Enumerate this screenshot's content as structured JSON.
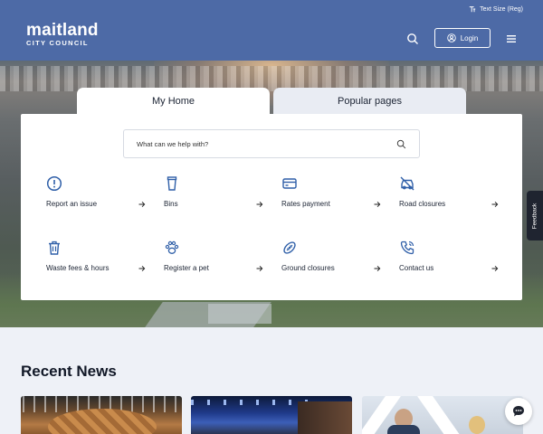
{
  "header": {
    "logo_main": "maitland",
    "logo_sub": "CITY COUNCIL",
    "text_size": "Text Size (Reg)",
    "login_label": "Login"
  },
  "tabs": [
    {
      "label": "My Home"
    },
    {
      "label": "Popular pages"
    }
  ],
  "search": {
    "placeholder": "What can we help with?"
  },
  "quick_links": [
    {
      "label": "Report an issue",
      "icon": "alert-circle-icon"
    },
    {
      "label": "Bins",
      "icon": "bin-icon"
    },
    {
      "label": "Rates payment",
      "icon": "credit-card-icon"
    },
    {
      "label": "Road closures",
      "icon": "car-off-icon"
    },
    {
      "label": "Waste fees & hours",
      "icon": "trash-icon"
    },
    {
      "label": "Register a pet",
      "icon": "paw-icon"
    },
    {
      "label": "Ground closures",
      "icon": "football-icon"
    },
    {
      "label": "Contact us",
      "icon": "phone-call-icon"
    }
  ],
  "feedback_label": "Feedback",
  "news": {
    "title": "Recent News"
  },
  "colors": {
    "header_bg": "#4d6aa6",
    "accent": "#2f5fa8",
    "page_bg": "#eef1f7"
  }
}
